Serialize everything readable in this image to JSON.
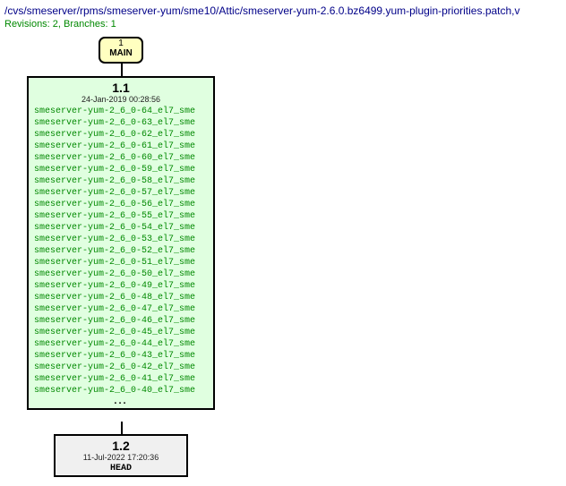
{
  "header": {
    "path": "/cvs/smeserver/rpms/smeserver-yum/sme10/Attic/smeserver-yum-2.6.0.bz6499.yum-plugin-priorities.patch,v",
    "revinfo": "Revisions: 2, Branches: 1"
  },
  "main": {
    "num": "1",
    "label": "MAIN"
  },
  "rev1": {
    "version": "1.1",
    "date": "24-Jan-2019 00:28:56",
    "tags": [
      "smeserver-yum-2_6_0-64_el7_sme",
      "smeserver-yum-2_6_0-63_el7_sme",
      "smeserver-yum-2_6_0-62_el7_sme",
      "smeserver-yum-2_6_0-61_el7_sme",
      "smeserver-yum-2_6_0-60_el7_sme",
      "smeserver-yum-2_6_0-59_el7_sme",
      "smeserver-yum-2_6_0-58_el7_sme",
      "smeserver-yum-2_6_0-57_el7_sme",
      "smeserver-yum-2_6_0-56_el7_sme",
      "smeserver-yum-2_6_0-55_el7_sme",
      "smeserver-yum-2_6_0-54_el7_sme",
      "smeserver-yum-2_6_0-53_el7_sme",
      "smeserver-yum-2_6_0-52_el7_sme",
      "smeserver-yum-2_6_0-51_el7_sme",
      "smeserver-yum-2_6_0-50_el7_sme",
      "smeserver-yum-2_6_0-49_el7_sme",
      "smeserver-yum-2_6_0-48_el7_sme",
      "smeserver-yum-2_6_0-47_el7_sme",
      "smeserver-yum-2_6_0-46_el7_sme",
      "smeserver-yum-2_6_0-45_el7_sme",
      "smeserver-yum-2_6_0-44_el7_sme",
      "smeserver-yum-2_6_0-43_el7_sme",
      "smeserver-yum-2_6_0-42_el7_sme",
      "smeserver-yum-2_6_0-41_el7_sme",
      "smeserver-yum-2_6_0-40_el7_sme"
    ],
    "ellipsis": "..."
  },
  "rev2": {
    "version": "1.2",
    "date": "11-Jul-2022 17:20:36",
    "head": "HEAD"
  }
}
